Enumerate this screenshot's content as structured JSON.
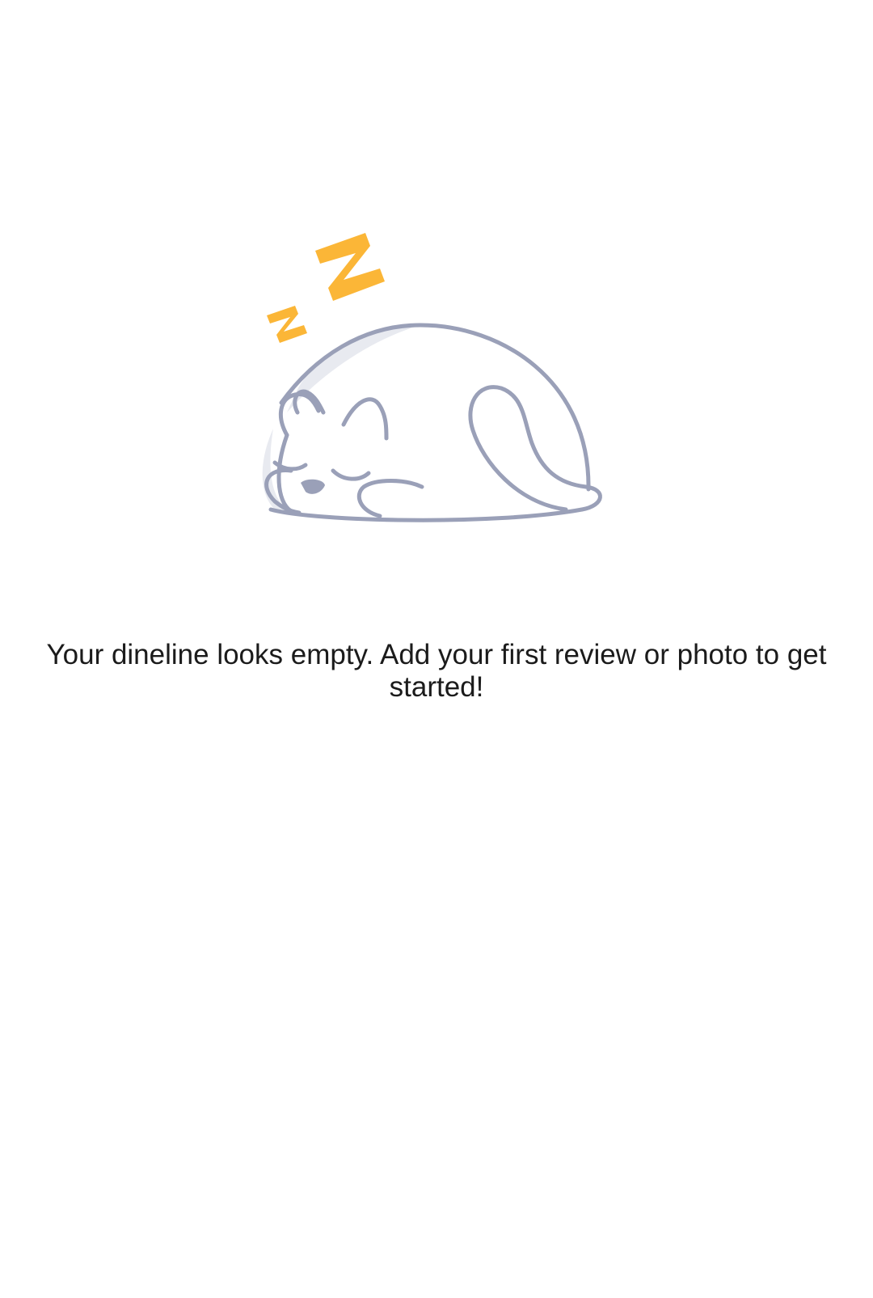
{
  "empty_state": {
    "illustration_icon": "sleeping-cat-icon",
    "message": "Your dineline looks empty. Add your first review or photo to get started!"
  },
  "colors": {
    "background": "#ffffff",
    "text": "#1b1b1b",
    "outline": "#9aa0b8",
    "shade": "#e8eaf0",
    "zzz": "#fbb637"
  }
}
